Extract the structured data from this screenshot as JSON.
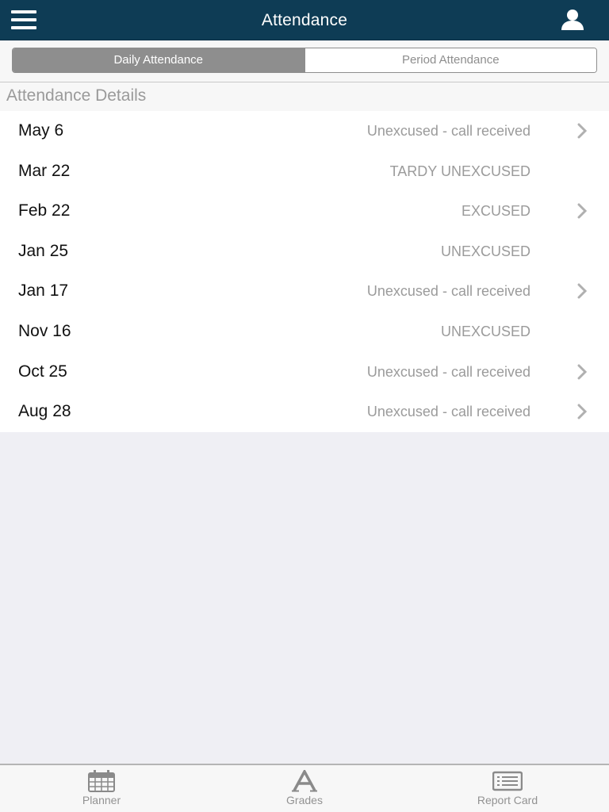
{
  "nav": {
    "title": "Attendance",
    "menu_icon": "hamburger-menu-icon",
    "profile_icon": "user-profile-icon",
    "bar_color": "#0e3c55"
  },
  "segments": {
    "items": [
      {
        "label": "Daily Attendance",
        "selected": true
      },
      {
        "label": "Period Attendance",
        "selected": false
      }
    ]
  },
  "section": {
    "title": "Attendance Details"
  },
  "records": [
    {
      "date": "May 6",
      "status": "Unexcused - call received",
      "has_detail": true
    },
    {
      "date": "Mar 22",
      "status": "TARDY UNEXCUSED",
      "has_detail": false
    },
    {
      "date": "Feb 22",
      "status": "EXCUSED",
      "has_detail": true
    },
    {
      "date": "Jan 25",
      "status": "UNEXCUSED",
      "has_detail": false
    },
    {
      "date": "Jan 17",
      "status": "Unexcused - call received",
      "has_detail": true
    },
    {
      "date": "Nov 16",
      "status": "UNEXCUSED",
      "has_detail": false
    },
    {
      "date": "Oct 25",
      "status": "Unexcused - call received",
      "has_detail": true
    },
    {
      "date": "Aug 28",
      "status": "Unexcused - call received",
      "has_detail": true
    }
  ],
  "tabbar": {
    "items": [
      {
        "label": "Planner",
        "icon": "calendar-icon"
      },
      {
        "label": "Grades",
        "icon": "grades-letter-a-icon"
      },
      {
        "label": "Report Card",
        "icon": "report-card-icon"
      }
    ]
  }
}
